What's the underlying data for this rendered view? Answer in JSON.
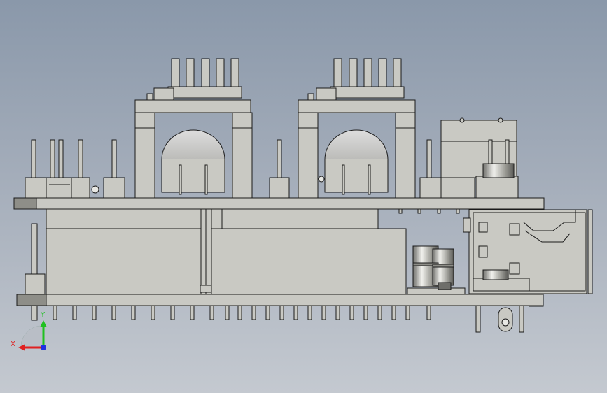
{
  "viewport": {
    "background_top": "#8a98aa",
    "background_bottom": "#c4c9d0",
    "part_fill": "#c9c9c3",
    "part_stroke": "#1a1a1a",
    "shade_fill": "#8e8e88"
  },
  "triad": {
    "x_label": "X",
    "y_label": "Y",
    "x_color": "#e02020",
    "y_color": "#20c020",
    "z_color": "#2030e0"
  }
}
